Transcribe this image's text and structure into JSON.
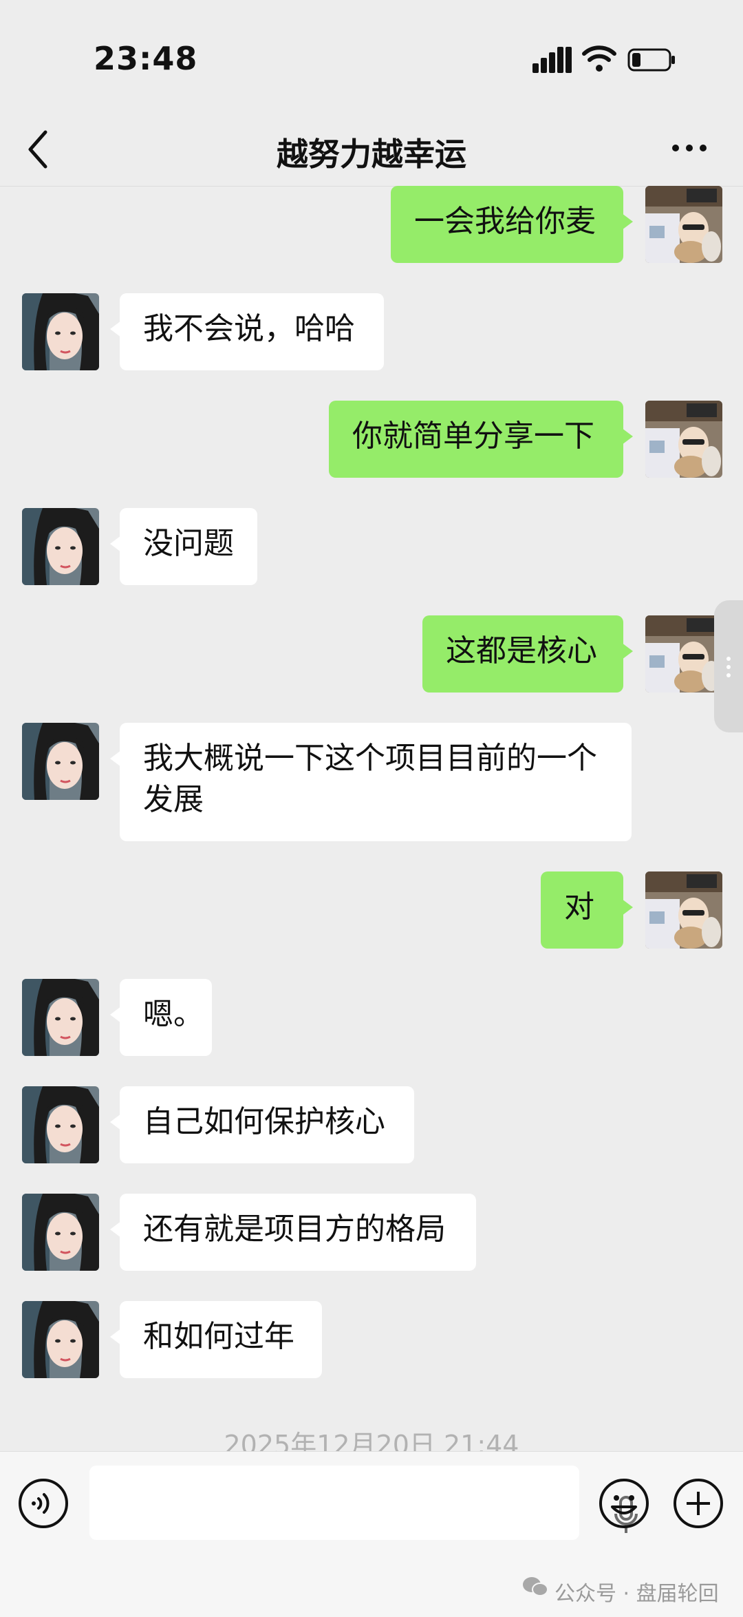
{
  "status_bar": {
    "time": "23:48"
  },
  "header": {
    "title": "越努力越幸运"
  },
  "messages": [
    {
      "side": "out",
      "text": "一会我给你麦"
    },
    {
      "side": "in",
      "text": "我不会说，哈哈"
    },
    {
      "side": "out",
      "text": "你就简单分享一下"
    },
    {
      "side": "in",
      "text": "没问题"
    },
    {
      "side": "out",
      "text": "这都是核心"
    },
    {
      "side": "in",
      "text": "我大概说一下这个项目目前的一个发展"
    },
    {
      "side": "out",
      "text": "对"
    },
    {
      "side": "in",
      "text": "嗯。"
    },
    {
      "side": "in",
      "text": "自己如何保护核心"
    },
    {
      "side": "in",
      "text": "还有就是项目方的格局"
    },
    {
      "side": "in",
      "text": "和如何过年"
    }
  ],
  "timestamp": "2025年12月20日 21:44",
  "watermark": {
    "text": "公众号 · 盘届轮回"
  },
  "colors": {
    "outgoing_bubble": "#95ec69",
    "incoming_bubble": "#ffffff",
    "background": "#ededed"
  }
}
